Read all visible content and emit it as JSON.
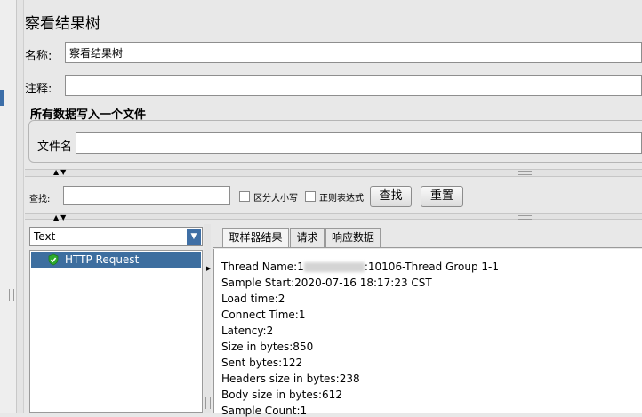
{
  "title": "察看结果树",
  "name_label": "名称:",
  "name_value": "察看结果树",
  "comment_label": "注释:",
  "comment_value": "",
  "file_group_title": "所有数据写入一个文件",
  "filename_label": "文件名",
  "filename_value": "",
  "search": {
    "label": "查找:",
    "value": "",
    "case_sensitive_label": "区分大小写",
    "regex_label": "正则表达式",
    "find_button": "查找",
    "reset_button": "重置"
  },
  "renderer_select": {
    "selected": "Text"
  },
  "tree": {
    "items": [
      {
        "label": "HTTP Request",
        "status": "success"
      }
    ]
  },
  "tabs": [
    {
      "label": "取样器结果",
      "active": true
    },
    {
      "label": "请求",
      "active": false
    },
    {
      "label": "响应数据",
      "active": false
    }
  ],
  "result": {
    "thread_name_prefix": "Thread Name:1",
    "thread_name_suffix": ":10106-Thread Group 1-1",
    "lines": [
      "Sample Start:2020-07-16 18:17:23 CST",
      "Load time:2",
      "Connect Time:1",
      "Latency:2",
      "Size in bytes:850",
      "Sent bytes:122",
      "Headers size in bytes:238",
      "Body size in bytes:612",
      "Sample Count:1"
    ]
  },
  "colors": {
    "selection": "#3d6e9f",
    "success_icon": "#2eaa2e"
  },
  "icons": {
    "tree_status": "green-shield-check-icon",
    "combo_arrow": "triangle-down-icon"
  }
}
